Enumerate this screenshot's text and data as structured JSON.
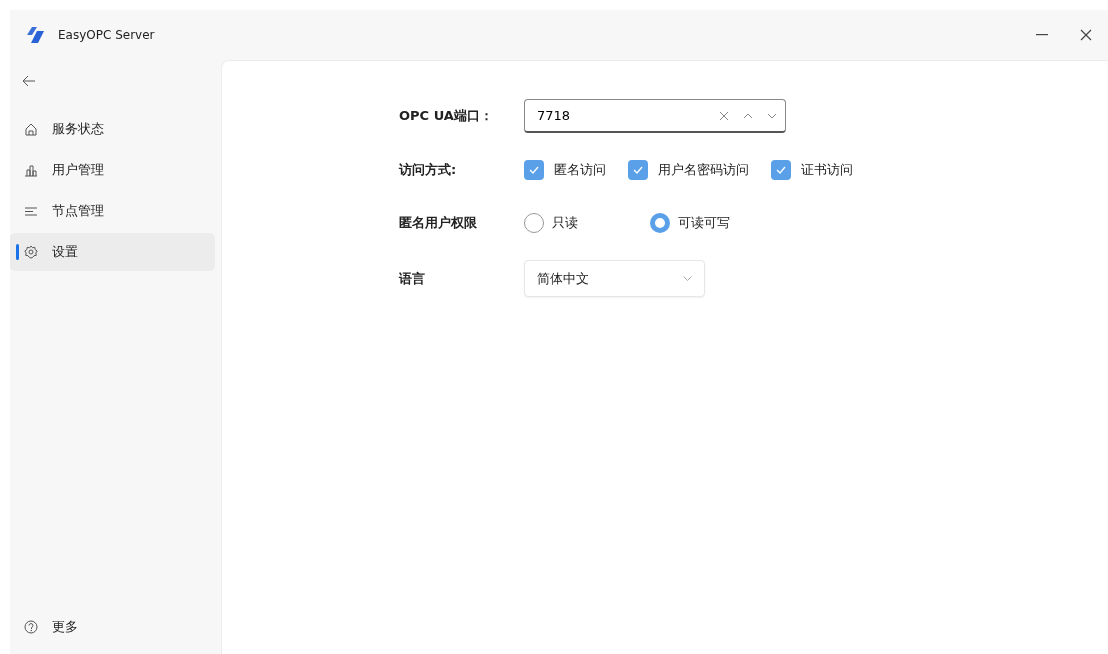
{
  "window": {
    "title": "EasyOPC Server"
  },
  "sidebar": {
    "items": [
      {
        "label": "服务状态",
        "selected": false
      },
      {
        "label": "用户管理",
        "selected": false
      },
      {
        "label": "节点管理",
        "selected": false
      },
      {
        "label": "设置",
        "selected": true
      }
    ],
    "footer": {
      "label": "更多"
    }
  },
  "settings": {
    "port": {
      "label": "OPC UA端口：",
      "value": "7718"
    },
    "access": {
      "label": "访问方式:",
      "options": [
        {
          "label": "匿名访问",
          "checked": true
        },
        {
          "label": "用户名密码访问",
          "checked": true
        },
        {
          "label": "证书访问",
          "checked": true
        }
      ]
    },
    "anon_permission": {
      "label": "匿名用户权限",
      "options": [
        {
          "label": "只读",
          "selected": false
        },
        {
          "label": "可读可写",
          "selected": true
        }
      ]
    },
    "language": {
      "label": "语言",
      "value": "简体中文"
    }
  }
}
